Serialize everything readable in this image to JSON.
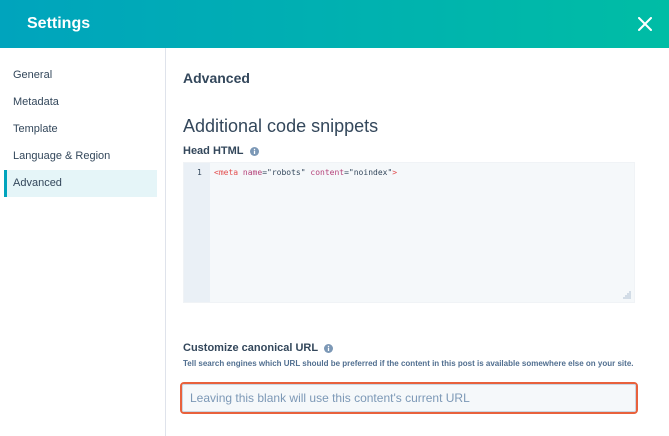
{
  "header": {
    "title": "Settings"
  },
  "icons": {
    "close": "close-icon",
    "info": "info-icon",
    "resize": "resize-handle-icon"
  },
  "colors": {
    "header_start": "#00a4bd",
    "header_end": "#00bda5",
    "active_accent": "#00a4bd",
    "highlight": "#e8613c"
  },
  "sidebar": {
    "items": [
      {
        "label": "General"
      },
      {
        "label": "Metadata"
      },
      {
        "label": "Template"
      },
      {
        "label": "Language & Region"
      },
      {
        "label": "Advanced",
        "active": true
      }
    ]
  },
  "main": {
    "section_title": "Advanced",
    "snippets_title": "Additional code snippets",
    "head_html": {
      "label": "Head HTML",
      "line_number": "1",
      "code": {
        "open": "<meta",
        "attr1": "name",
        "val1": "\"robots\"",
        "attr2": "content",
        "val2": "\"noindex\"",
        "close": ">"
      }
    },
    "canonical": {
      "label": "Customize canonical URL",
      "help": "Tell search engines which URL should be preferred if the content in this post is available somewhere else on your site.",
      "placeholder": "Leaving this blank will use this content's current URL",
      "value": ""
    }
  }
}
